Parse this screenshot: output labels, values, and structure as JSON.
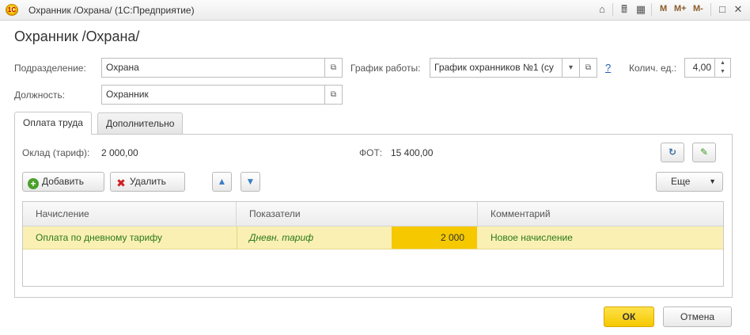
{
  "window": {
    "title": "Охранник /Охрана/  (1С:Предприятие)",
    "logo_text": "1С",
    "toolbar_m": [
      "M",
      "M+",
      "M-"
    ]
  },
  "form": {
    "title": "Охранник /Охрана/",
    "subdivision_label": "Подразделение:",
    "subdivision_value": "Охрана",
    "position_label": "Должность:",
    "position_value": "Охранник",
    "schedule_label": "График работы:",
    "schedule_value": "График охранников №1 (су",
    "help": "?",
    "units_label": "Колич. ед.:",
    "units_value": "4,00"
  },
  "tabs": [
    {
      "label": "Оплата труда",
      "active": true
    },
    {
      "label": "Дополнительно",
      "active": false
    }
  ],
  "payment": {
    "salary_label": "Оклад (тариф):",
    "salary_value": "2 000,00",
    "fot_label": "ФОТ:",
    "fot_value": "15 400,00",
    "add_label": "Добавить",
    "delete_label": "Удалить",
    "more_label": "Еще"
  },
  "table": {
    "columns": [
      "Начисление",
      "Показатели",
      "Комментарий"
    ],
    "rows": [
      {
        "accrual": "Оплата по дневному тарифу",
        "indicator": "Дневн. тариф",
        "value": "2 000",
        "comment": "Новое начисление"
      }
    ]
  },
  "footer": {
    "ok_label": "ОК",
    "cancel_label": "Отмена"
  },
  "colors": {
    "accent_yellow": "#f5c800",
    "row_highlight": "#fbf0b3",
    "green_text": "#2a7a1a"
  }
}
